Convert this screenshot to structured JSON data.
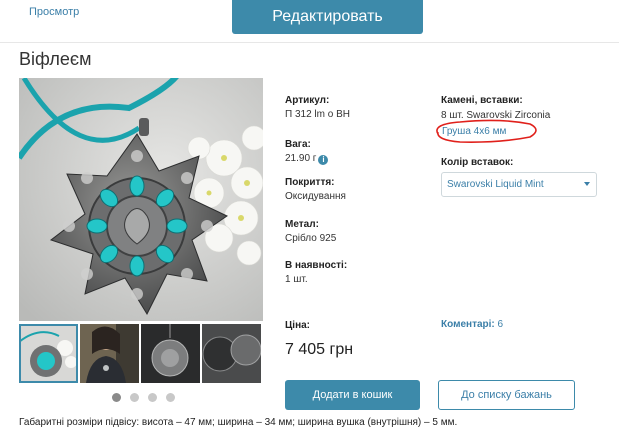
{
  "header": {
    "preview_link": "Просмотр",
    "edit_button": "Редактировать"
  },
  "product": {
    "title": "Віфлеєм",
    "article_label": "Артикул:",
    "article_value": "П 312 lm о ВН",
    "weight_label": "Вага:",
    "weight_value": "21.90 г",
    "coating_label": "Покриття:",
    "coating_value": "Оксидування",
    "metal_label": "Метал:",
    "metal_value": "Срібло 925",
    "stock_label": "В наявності:",
    "stock_value": "1 шт.",
    "stones_label": "Камені, вставки:",
    "stones_value": "8 шт. Swarovski Zirconia",
    "stones_shape_link": "Груша 4х6 мм",
    "insert_color_label": "Колір вставок:",
    "insert_color_selected": "Swarovski Liquid Mint",
    "price_label": "Ціна:",
    "price_value": "7 405 грн",
    "comments_label": "Коментарі:",
    "comments_count": "6",
    "dimensions_text": "Габаритні розміри підвісу: висота – 47 мм; ширина – 34 мм; ширина вушка (внутрішня) – 5 мм."
  },
  "actions": {
    "add_to_cart": "Додати в кошик",
    "add_to_wishlist": "До списку бажань"
  },
  "gallery": {
    "thumbnail_count": 4,
    "active_thumbnail": 1,
    "dot_count": 4,
    "active_dot": 1
  },
  "colors": {
    "accent": "#3d8aaa",
    "link": "#3b7fa8",
    "annotation": "#e0201b"
  },
  "icons": {
    "info": "info-icon",
    "select_arrow": "chevron-down-icon"
  }
}
